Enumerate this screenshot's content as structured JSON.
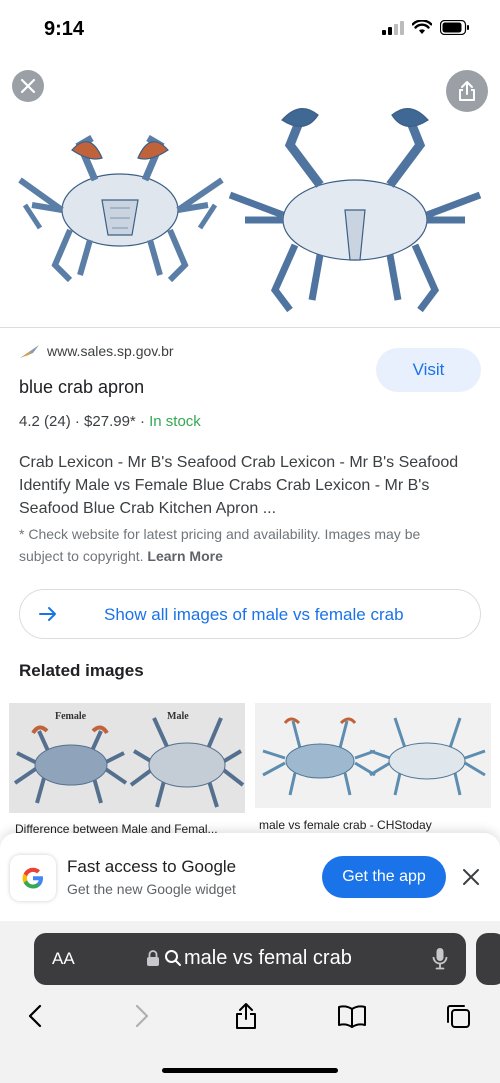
{
  "status": {
    "time": "9:14"
  },
  "result": {
    "source_domain": "www.sales.sp.gov.br",
    "title": "blue crab apron",
    "visit_label": "Visit",
    "rating": "4.2 (24)",
    "price": "$27.99*",
    "stock": "In stock",
    "description": "Crab Lexicon - Mr B's Seafood Crab Lexicon - Mr B's Seafood Identify Male vs Female Blue Crabs Crab Lexicon - Mr B's Seafood Blue Crab Kitchen Apron ...",
    "disclaimer": "* Check website for latest pricing and availability. Images may be subject to copyright.",
    "learn_more": "Learn More"
  },
  "show_all_label": "Show all images of male vs female crab",
  "related": {
    "title": "Related images",
    "items": [
      {
        "caption": "Difference between Male and Femal...",
        "label_female": "Female",
        "label_male": "Male"
      },
      {
        "caption": "male vs female crab - CHStoday"
      }
    ]
  },
  "promo": {
    "title": "Fast access to Google",
    "subtitle": "Get the new Google widget",
    "cta": "Get the app"
  },
  "browser": {
    "text_size_label": "AA",
    "address_text": "male vs femal crab"
  },
  "colors": {
    "accent": "#1a73e8",
    "stock": "#34a853",
    "crab_blue": "#4a6f96"
  }
}
